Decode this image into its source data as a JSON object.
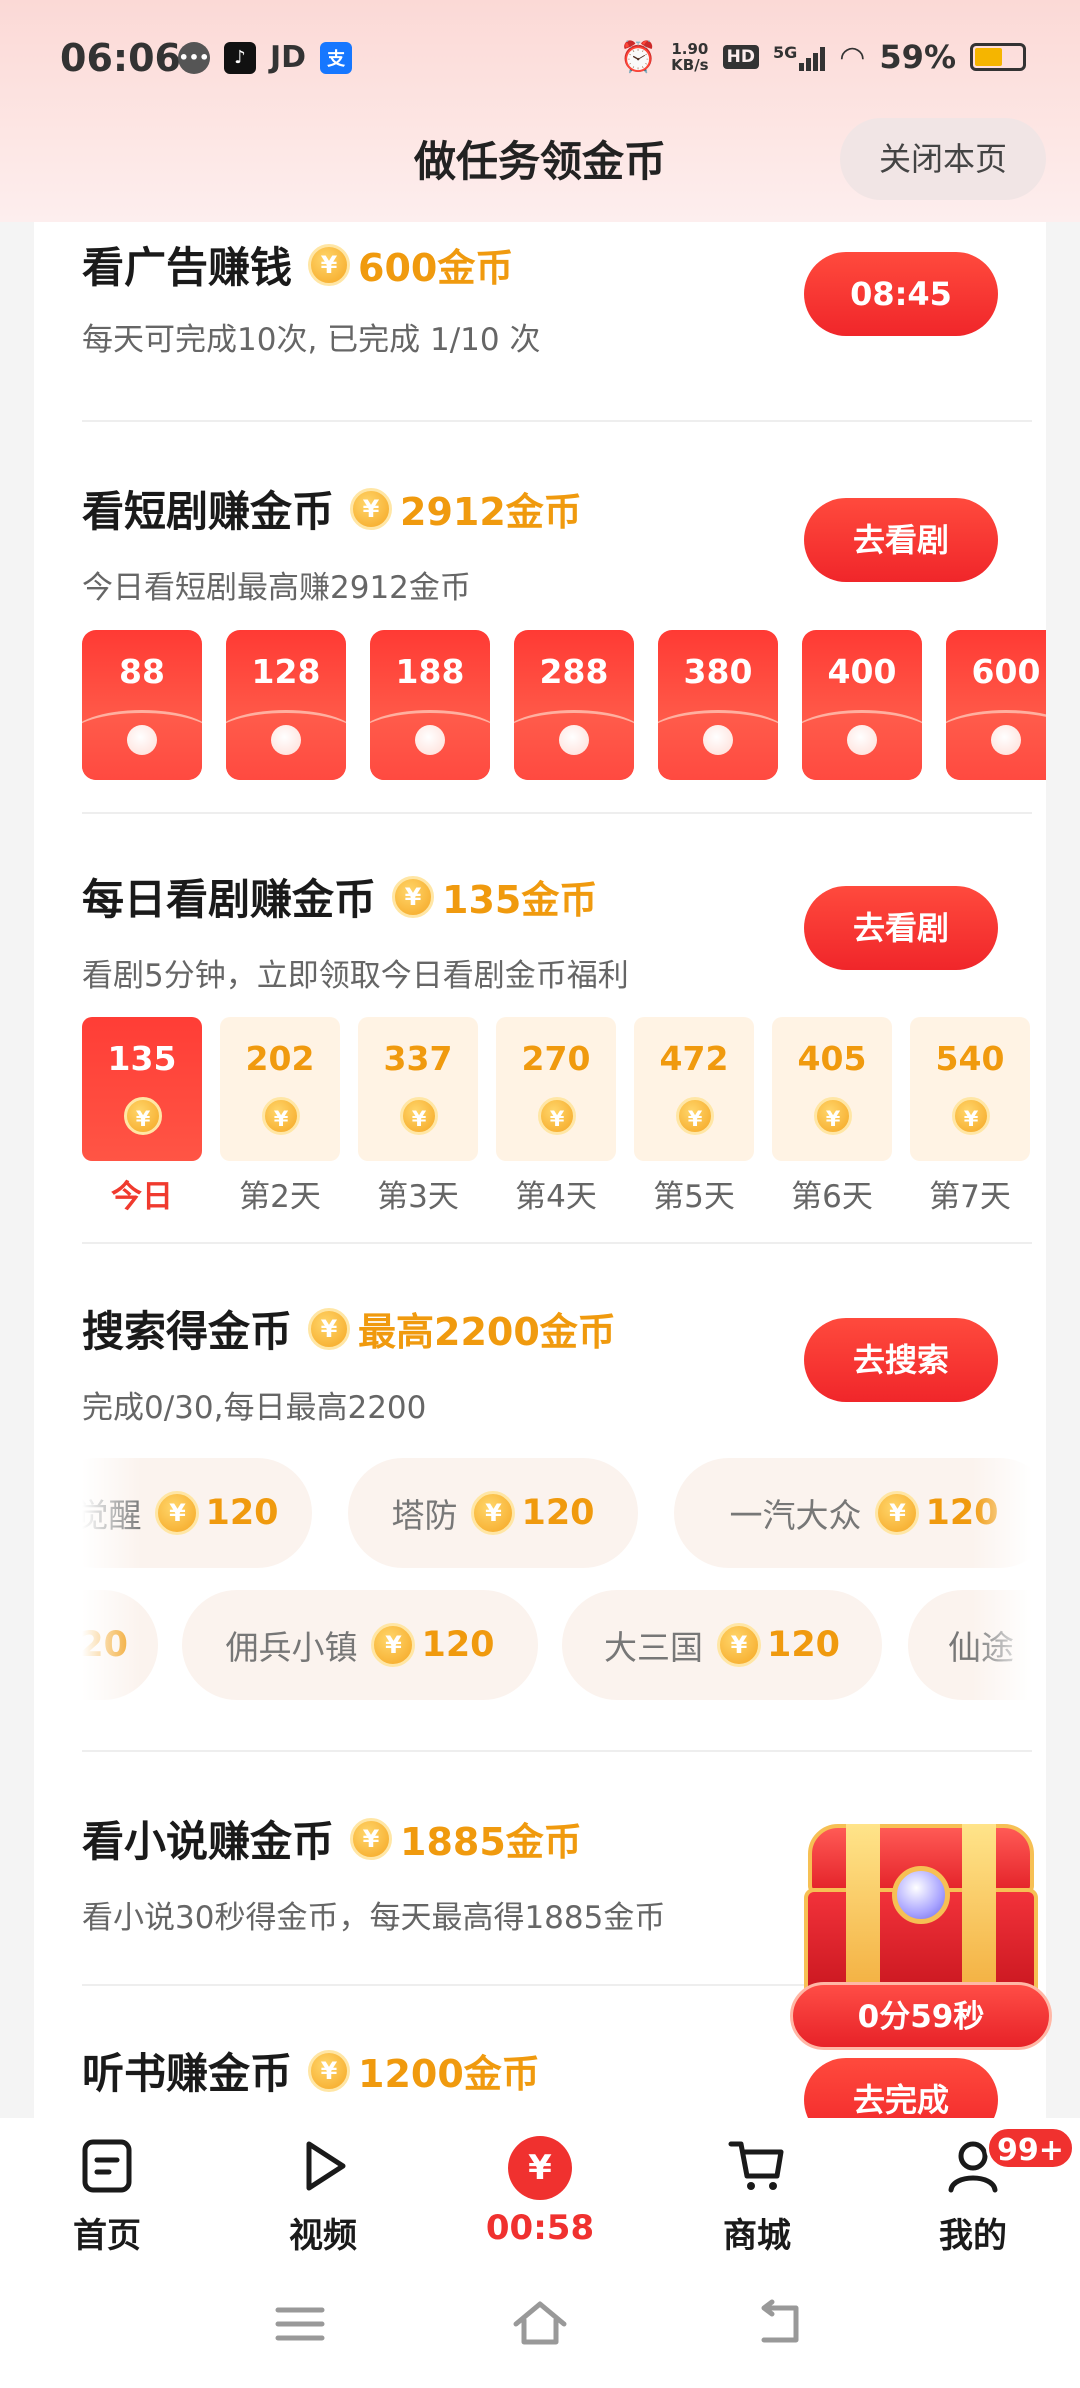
{
  "status_bar": {
    "time": "06:06",
    "carrier_icons": [
      "wechat-icon",
      "douyin-icon",
      "jd-label",
      "alipay-icon"
    ],
    "jd": "JD",
    "speed_value": "1.90",
    "speed_unit": "KB/s",
    "hd": "HD",
    "network": "5G",
    "battery": "59%",
    "battery_level": 0.59
  },
  "header": {
    "title": "做任务领金币",
    "close_label": "关闭本页"
  },
  "tasks": {
    "ad": {
      "title": "看广告赚钱",
      "reward": "600金币",
      "sub": "每天可完成10次, 已完成 1/10 次",
      "button": "08:45"
    },
    "short_drama": {
      "title": "看短剧赚金币",
      "reward": "2912金币",
      "sub": "今日看短剧最高赚2912金币",
      "button": "去看剧",
      "envelopes": [
        "88",
        "128",
        "188",
        "288",
        "380",
        "400",
        "600"
      ]
    },
    "daily_drama": {
      "title": "每日看剧赚金币",
      "reward": "135金币",
      "sub": "看剧5分钟，立即领取今日看剧金币福利",
      "button": "去看剧",
      "days": [
        {
          "value": "135",
          "label": "今日"
        },
        {
          "value": "202",
          "label": "第2天"
        },
        {
          "value": "337",
          "label": "第3天"
        },
        {
          "value": "270",
          "label": "第4天"
        },
        {
          "value": "472",
          "label": "第5天"
        },
        {
          "value": "405",
          "label": "第6天"
        },
        {
          "value": "540",
          "label": "第7天"
        }
      ]
    },
    "search": {
      "title": "搜索得金币",
      "reward": "最高2200金币",
      "sub": "完成0/30,每日最高2200",
      "button": "去搜索",
      "row1": [
        {
          "name": "觉醒",
          "amount": "120"
        },
        {
          "name": "塔防",
          "amount": "120"
        },
        {
          "name": "一汽大众",
          "amount": "120"
        }
      ],
      "row2": [
        {
          "name": "",
          "amount": "20"
        },
        {
          "name": "佣兵小镇",
          "amount": "120"
        },
        {
          "name": "大三国",
          "amount": "120"
        },
        {
          "name": "仙途",
          "amount": ""
        }
      ]
    },
    "novel": {
      "title": "看小说赚金币",
      "reward": "1885金币",
      "sub": "看小说30秒得金币，每天最高得1885金币"
    },
    "audiobook": {
      "title": "听书赚金币",
      "reward": "1200金币",
      "button": "去完成"
    }
  },
  "chest": {
    "timer": "0分59秒"
  },
  "bottom_nav": {
    "home": "首页",
    "video": "视频",
    "center_timer": "00:58",
    "mall": "商城",
    "mine": "我的",
    "badge": "99+"
  },
  "colors": {
    "accent_red": "#f0262a",
    "coin_orange": "#f09a0e"
  }
}
